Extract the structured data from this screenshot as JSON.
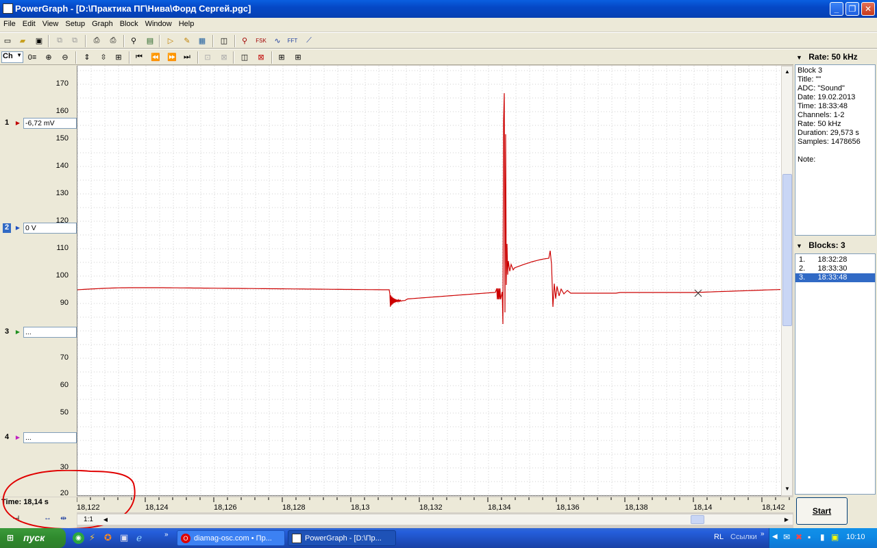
{
  "window": {
    "title": "PowerGraph - [D:\\Практика ПГ\\Нива\\Форд Сергей.pgc]"
  },
  "menu": [
    "File",
    "Edit",
    "View",
    "Setup",
    "Graph",
    "Block",
    "Window",
    "Help"
  ],
  "toolbar2": {
    "ch_label": "Ch",
    "zero_label": "0"
  },
  "channels": [
    {
      "num": "1",
      "value": "-6,72 mV",
      "arrow_color": "#c00000"
    },
    {
      "num": "2",
      "value": "0 V",
      "arrow_color": "#2050c0"
    },
    {
      "num": "3",
      "value": "...",
      "arrow_color": "#209020"
    },
    {
      "num": "4",
      "value": "...",
      "arrow_color": "#c020c0"
    }
  ],
  "yaxis": {
    "ticks": [
      "170",
      "160",
      "150",
      "140",
      "130",
      "120",
      "110",
      "100",
      "90",
      "70",
      "60",
      "50",
      "30",
      "20"
    ]
  },
  "xaxis": {
    "ticks": [
      "18,122",
      "18,124",
      "18,126",
      "18,128",
      "18,13",
      "18,132",
      "18,134",
      "18,136",
      "18,138",
      "18,14",
      "18,142"
    ]
  },
  "time_label": "Time: 18,14 s",
  "zoom_ratio": "1:1",
  "right_panel": {
    "rate_header": "Rate: 50 kHz",
    "info": [
      "Block 3",
      "Title: \"\"",
      "ADC: \"Sound\"",
      "Date: 19.02.2013",
      "Time: 18:33:48",
      "Channels: 1-2",
      "Rate: 50 kHz",
      "Duration: 29,573 s",
      "Samples: 1478656",
      "",
      "Note:"
    ],
    "blocks_header": "Blocks: 3",
    "blocks": [
      {
        "num": "1.",
        "time": "18:32:28"
      },
      {
        "num": "2.",
        "time": "18:33:30"
      },
      {
        "num": "3.",
        "time": "18:33:48"
      }
    ],
    "start_label": "Start"
  },
  "taskbar": {
    "start_label": "пуск",
    "tasks": [
      "diamag-osc.com • Пр...",
      "PowerGraph - [D:\\Пр..."
    ],
    "lang": "RL",
    "links": "Ссылки",
    "clock": "10:10"
  },
  "colors": {
    "signal": "#cc0000",
    "grid": "#c8c8c8",
    "accent": "#316ac5"
  }
}
